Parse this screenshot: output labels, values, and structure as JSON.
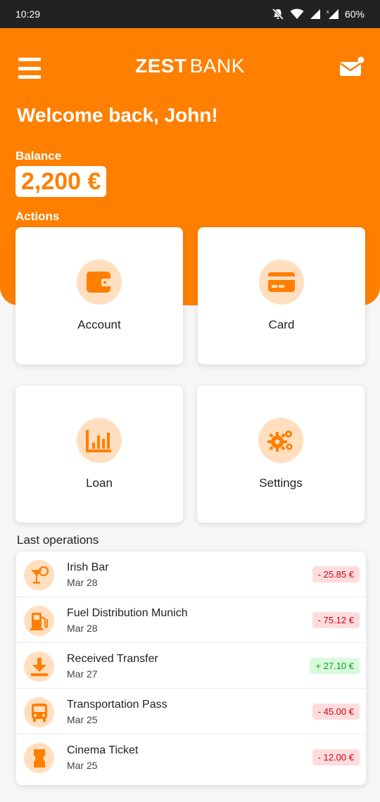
{
  "status_bar": {
    "time": "10:29",
    "battery": "60%"
  },
  "header": {
    "brand_part1": "ZEST",
    "brand_part2": "BANK",
    "welcome": "Welcome back, John!",
    "balance_label": "Balance",
    "balance_value": "2,200 €",
    "actions_label": "Actions"
  },
  "actions": [
    {
      "label": "Account",
      "icon": "wallet-icon"
    },
    {
      "label": "Card",
      "icon": "credit-card-icon"
    },
    {
      "label": "Loan",
      "icon": "bar-chart-icon"
    },
    {
      "label": "Settings",
      "icon": "gears-icon"
    }
  ],
  "operations_label": "Last operations",
  "operations": [
    {
      "name": "Irish Bar",
      "date": "Mar 28",
      "amount": "- 25.85 €",
      "type": "debit",
      "icon": "cocktail-icon"
    },
    {
      "name": "Fuel Distribution Munich",
      "date": "Mar 28",
      "amount": "- 75.12 €",
      "type": "debit",
      "icon": "gas-pump-icon"
    },
    {
      "name": "Received Transfer",
      "date": "Mar 27",
      "amount": "+ 27.10 €",
      "type": "credit",
      "icon": "download-icon"
    },
    {
      "name": "Transportation Pass",
      "date": "Mar 25",
      "amount": "- 45.00 €",
      "type": "debit",
      "icon": "bus-icon"
    },
    {
      "name": "Cinema Ticket",
      "date": "Mar 25",
      "amount": "- 12.00 €",
      "type": "debit",
      "icon": "ticket-icon"
    }
  ],
  "colors": {
    "brand_orange": "#ff7f00",
    "icon_bg": "#ffdfbf",
    "debit_bg": "#ffdcdc",
    "debit_text": "#d0021b",
    "credit_bg": "#d8fbdc",
    "credit_text": "#0f9d28",
    "status_bar": "#222222"
  }
}
